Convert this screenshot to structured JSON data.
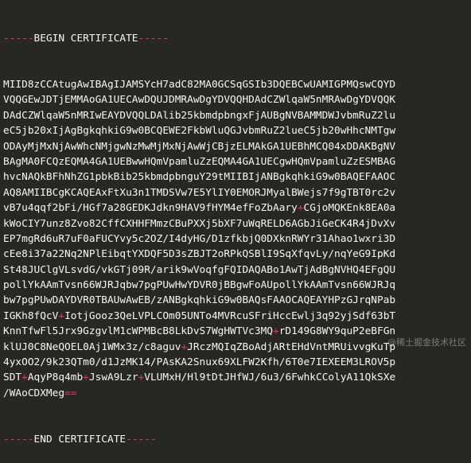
{
  "header": {
    "dashes": "-----",
    "label": "BEGIN CERTIFICATE",
    "trail": "-----"
  },
  "lines": [
    "MIID8zCCAtugAwIBAgIJAMSYcH7adC82MA0GCSqGSIb3DQEBCwUAMIGPMQswCQYD",
    "VQQGEwJDTjEMMAoGA1UECAwDQUJDMRAwDgYDVQQHDAdCZWlqaW5nMRAwDgYDVQQK",
    "DAdCZWlqaW5nMRIwEAYDVQQLDAlib25kbmdpbngxFjAUBgNVBAMMDWJvbmRuZ2lu",
    "eC5jb20xIjAgBgkqhkiG9w0BCQEWE2FkbWluQGJvbmRuZ2lueC5jb20wHhcNMTgw",
    "ODAyMjMxNjAwWhcNMjgwNzMwMjMxNjAwWjCBjzELMAkGA1UEBhMCQ04xDDAKBgNV",
    "BAgMA0FCQzEQMA4GA1UEBwwHQmVpamluZzEQMA4GA1UECgwHQmVpamluZzESMBAG",
    "hvcNAQkBFhNhZG1pbkBib25kbmdpbnguY29tMIIBIjANBgkqhkiG9w0BAQEFAAOC",
    "AQ8AMIIBCgKCAQEAxFtXu3n1TMDSVw7E5YlIY0EMORJMyalBWejs7f9gTBT0rc2v",
    "vB7u4qqf2bFi/HGf7a28GEDKJdkn9HAV9fHYM4efFoZbAary+CGjoMQKEnk8EA0a",
    "kWoCIY7unz8Zvo82CffCXHHFMmzCBuPXXj5bXF7uWqRELD6AGbJiGeCK4R4jDvXv",
    "EP7mgRd6uR7uF0aFUCYvy5c2OZ/I4dyHG/D1zfkbjQ0DXknRWYr31Ahao1wxri3D",
    "cEe8i37a22Nq2NPlEibqtYXDQF5D3sZBJT2oRPkQSBlI9SqXfqvLy/nqYeG9IpKd",
    "St48JUClgVLsvdG/vkGTj09R/arik9wVoqfgFQIDAQABo1AwTjAdBgNVHQ4EFgQU",
    "pollYkAAmTvsn66WJRJqbw7pgPUwHwYDVR0jBBgwFoAUpollYkAAmTvsn66WJRJq",
    "bw7pgPUwDAYDVR0TBAUwAwEB/zANBgkqhkiG9w0BAQsFAAOCAQEAYHPzGJrqNPab",
    "IGKh8fQcV+IotjGooz3QeLVPLCOm05UNTo4MVRcuSFriHccEwlj3q92yjSdf63bT",
    "KnnTfwFl5Jrx9GzgvlM1cWPMBcB8LkDvS7WgHWTVc3MQ+rD149G8WY9quP2eBFGn",
    "klUJ0C8NeQOEL0Aj1WMx3z/c8aguv+JRczMQIqZBoAdjARtEHdVntMRUivvgKuTp",
    "4yxOO2/9k23QTm0/d1JzMK14/PAsKA2Snux69XLFW2Kfh/6T0e7IEXEEM3LROV5p",
    "SDT+AqyP8q4mb+JswA9Lzr+VLUMxH/Hl9tDtJHfWJ/6u3/6FwhkCColyA11QkSXe",
    "/WAoCDXMeg=="
  ],
  "footer": {
    "dashes": "-----",
    "label": "END CERTIFICATE",
    "trail": "-----"
  },
  "watermark": "@稀土掘金技术社区"
}
